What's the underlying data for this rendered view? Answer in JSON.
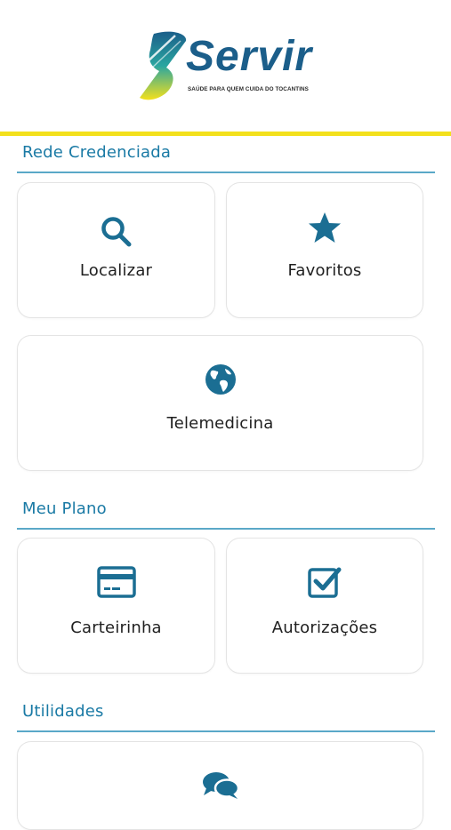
{
  "header": {
    "brand": "Servir",
    "tagline": "SAÚDE PARA QUEM CUIDA DO TOCANTINS"
  },
  "colors": {
    "accent": "#1a7aa5",
    "icon": "#1b6e93",
    "header_bar": "#f3e01c"
  },
  "sections": {
    "rede": {
      "title": "Rede Credenciada",
      "localizar": {
        "label": "Localizar",
        "icon": "search-icon"
      },
      "favoritos": {
        "label": "Favoritos",
        "icon": "star-icon"
      },
      "telemedicina": {
        "label": "Telemedicina",
        "icon": "globe-icon"
      }
    },
    "plano": {
      "title": "Meu Plano",
      "carteirinha": {
        "label": "Carteirinha",
        "icon": "card-icon"
      },
      "autorizacoes": {
        "label": "Autorizações",
        "icon": "checkbox-icon"
      }
    },
    "utilidades": {
      "title": "Utilidades",
      "chat": {
        "icon": "chat-icon"
      }
    }
  }
}
